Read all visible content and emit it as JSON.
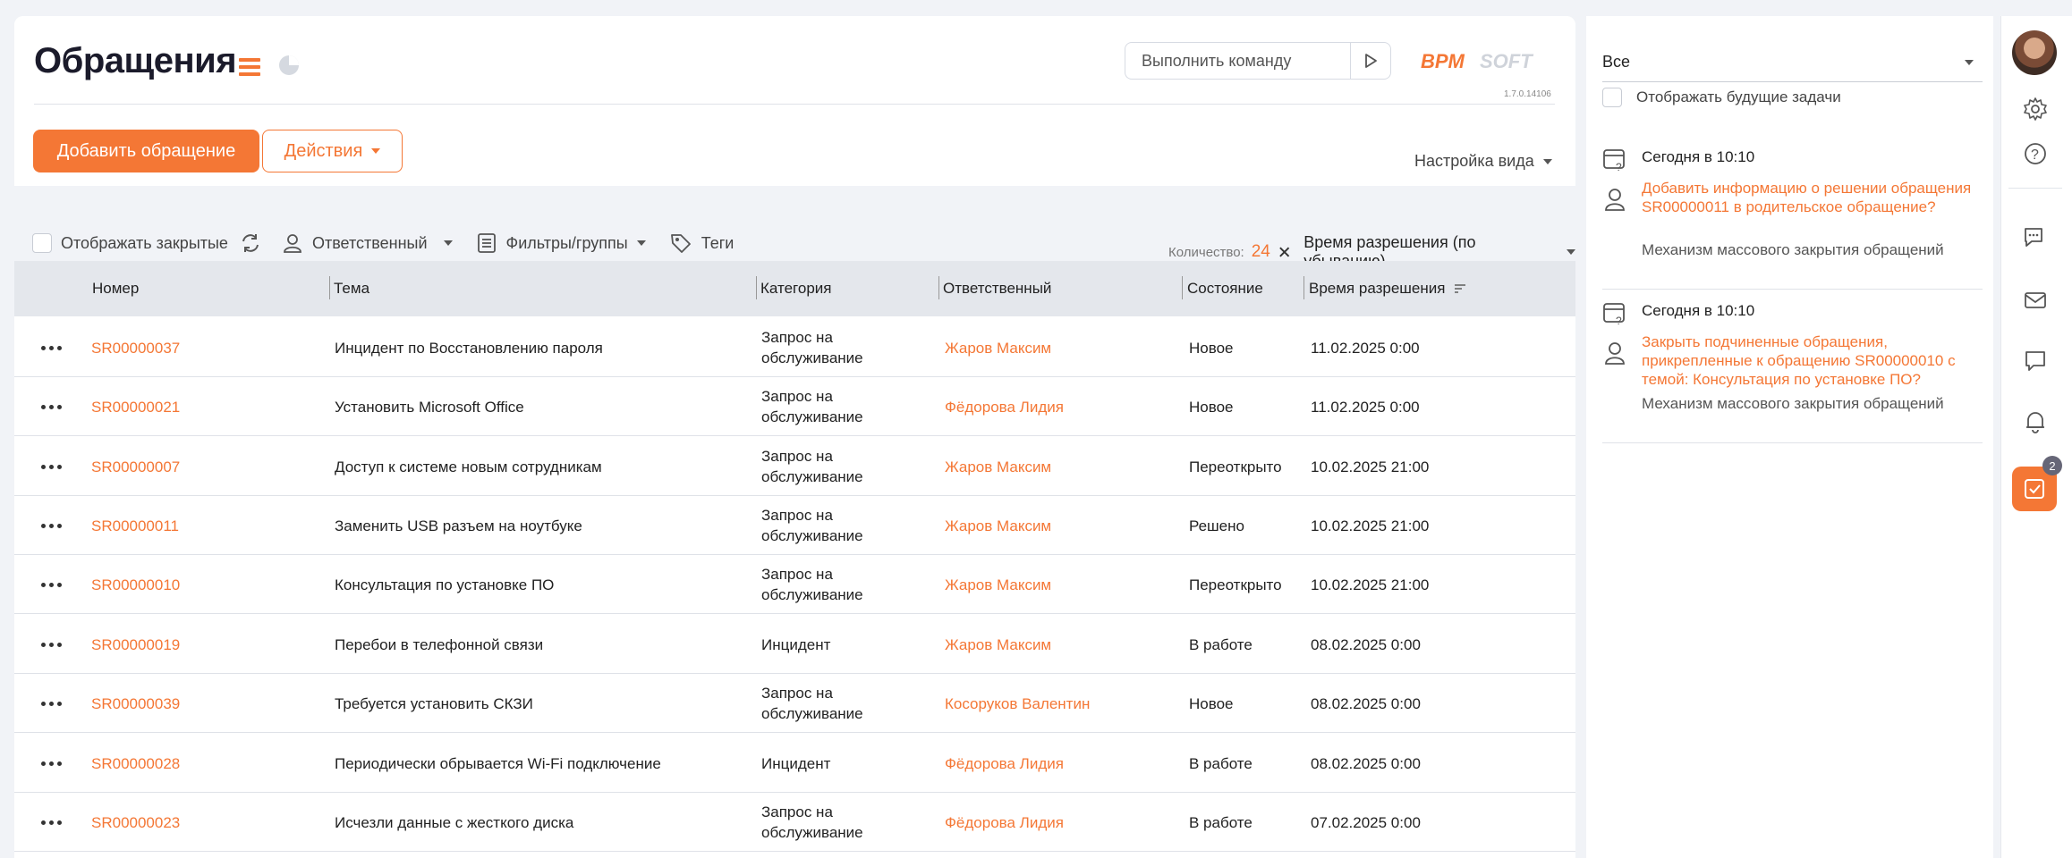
{
  "header": {
    "title": "Обращения",
    "command_placeholder": "Выполнить команду",
    "logo_text": "BPMSOFT",
    "version": "1.7.0.14106",
    "add_button": "Добавить обращение",
    "actions_button": "Действия",
    "view_settings": "Настройка вида"
  },
  "toolbar": {
    "show_closed": "Отображать закрытые",
    "owner_filter": "Ответственный",
    "filters_groups": "Фильтры/группы",
    "tags": "Теги",
    "count_label": "Количество:",
    "count_value": "24",
    "sort_label": "Время разрешения (по убыванию)"
  },
  "table": {
    "columns": [
      "Номер",
      "Тема",
      "Категория",
      "Ответственный",
      "Состояние",
      "Время разрешения"
    ],
    "rows": [
      {
        "number": "SR00000037",
        "subject": "Инцидент по Восстановлению пароля",
        "category": "Запрос на обслуживание",
        "owner": "Жаров Максим",
        "status": "Новое",
        "time": "11.02.2025 0:00"
      },
      {
        "number": "SR00000021",
        "subject": "Установить Microsoft Office",
        "category": "Запрос на обслуживание",
        "owner": "Фёдорова Лидия",
        "status": "Новое",
        "time": "11.02.2025 0:00"
      },
      {
        "number": "SR00000007",
        "subject": "Доступ к системе новым сотрудникам",
        "category": "Запрос на обслуживание",
        "owner": "Жаров Максим",
        "status": "Переоткрыто",
        "time": "10.02.2025 21:00"
      },
      {
        "number": "SR00000011",
        "subject": "Заменить USB разъем на ноутбуке",
        "category": "Запрос на обслуживание",
        "owner": "Жаров Максим",
        "status": "Решено",
        "time": "10.02.2025 21:00"
      },
      {
        "number": "SR00000010",
        "subject": "Консультация по установке ПО",
        "category": "Запрос на обслуживание",
        "owner": "Жаров Максим",
        "status": "Переоткрыто",
        "time": "10.02.2025 21:00"
      },
      {
        "number": "SR00000019",
        "subject": "Перебои в телефонной связи",
        "category": "Инцидент",
        "owner": "Жаров Максим",
        "status": "В работе",
        "time": "08.02.2025 0:00"
      },
      {
        "number": "SR00000039",
        "subject": "Требуется установить СКЗИ",
        "category": "Запрос на обслуживание",
        "owner": "Косоруков Валентин",
        "status": "Новое",
        "time": "08.02.2025 0:00"
      },
      {
        "number": "SR00000028",
        "subject": "Периодически обрывается Wi-Fi подключение",
        "category": "Инцидент",
        "owner": "Фёдорова Лидия",
        "status": "В работе",
        "time": "08.02.2025 0:00"
      },
      {
        "number": "SR00000023",
        "subject": "Исчезли данные с жесткого диска",
        "category": "Запрос на обслуживание",
        "owner": "Фёдорова Лидия",
        "status": "В работе",
        "time": "07.02.2025 0:00"
      }
    ]
  },
  "sidebar": {
    "filter_value": "Все",
    "future_tasks": "Отображать будущие задачи",
    "tasks": [
      {
        "time": "Сегодня в 10:10",
        "title": "Добавить информацию о решении обращения SR00000011 в родительское обращение?",
        "source": "Механизм массового закрытия обращений"
      },
      {
        "time": "Сегодня в 10:10",
        "title": "Закрыть подчиненные обращения, прикрепленные к обращению SR00000010 с темой: Консультация по установке ПО?",
        "source": "Механизм массового закрытия обращений"
      }
    ]
  },
  "rail": {
    "task_badge": "2"
  },
  "colors": {
    "accent": "#f47735",
    "header_row": "#e4e7ec",
    "background": "#f1f3f7"
  }
}
